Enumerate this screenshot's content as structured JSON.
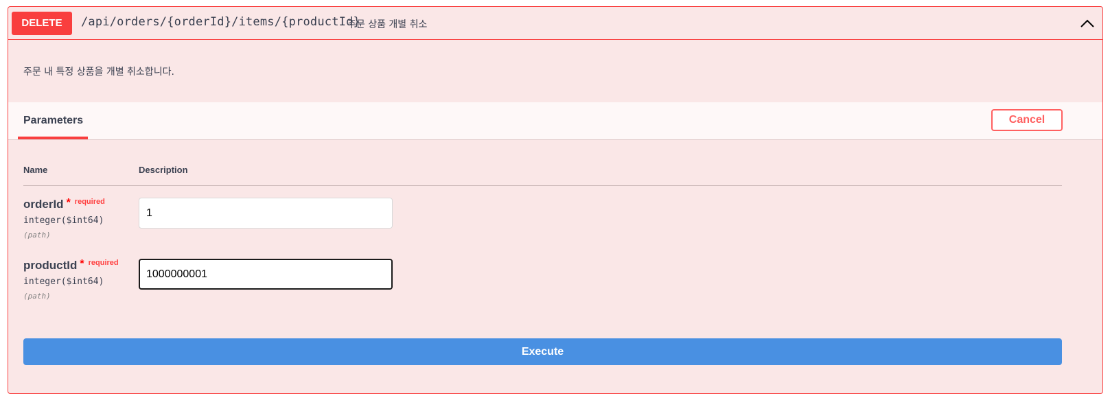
{
  "operation": {
    "method": "DELETE",
    "path": "/api/orders/{orderId}/items/{productId}",
    "summary": "주문 상품 개별 취소",
    "description": "주문 내 특정 상품을 개별 취소합니다.",
    "collapse_icon": "chevron-up-icon"
  },
  "tabs": {
    "parameters_label": "Parameters",
    "cancel_label": "Cancel"
  },
  "columns": {
    "name": "Name",
    "description": "Description"
  },
  "parameters": [
    {
      "name": "orderId",
      "required_mark": "*",
      "required_label": "required",
      "type": "integer($int64)",
      "in": "(path)",
      "value": "1"
    },
    {
      "name": "productId",
      "required_mark": "*",
      "required_label": "required",
      "type": "integer($int64)",
      "in": "(path)",
      "value": "1000000001"
    }
  ],
  "execute_label": "Execute",
  "colors": {
    "method": "#f93e3e",
    "block_background": "#fae7e7",
    "execute": "#4990e2",
    "cancel": "#ff6060"
  }
}
